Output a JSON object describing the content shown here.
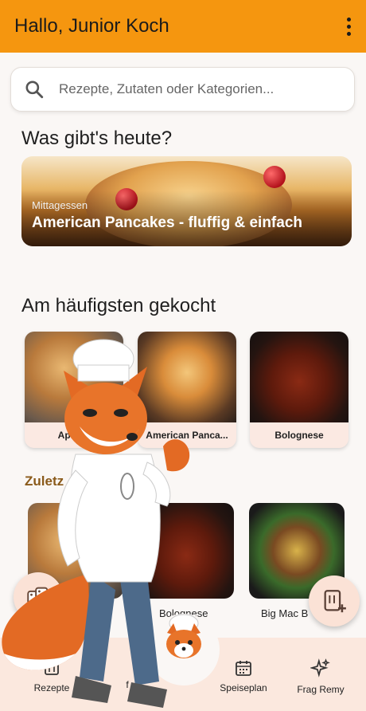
{
  "colors": {
    "appbar": "#f5960f",
    "accent_text": "#8a5a1a",
    "card_bg": "#fbe9e2"
  },
  "header": {
    "title": "Hallo, Junior Koch",
    "menu_icon": "more-vert-icon"
  },
  "search": {
    "placeholder": "Rezepte, Zutaten oder Kategorien...",
    "value": ""
  },
  "today": {
    "heading": "Was gibt's heute?",
    "featured": {
      "category": "Mittagessen",
      "title": "American Pancakes - fluffig & einfach"
    }
  },
  "most_cooked": {
    "heading": "Am häufigsten gekocht",
    "items": [
      {
        "label": "Apfelm"
      },
      {
        "label": "American Panca..."
      },
      {
        "label": "Bolognese"
      }
    ]
  },
  "recent": {
    "heading": "Zuletz",
    "items": [
      {
        "label": ""
      },
      {
        "label": "Bolognese"
      },
      {
        "label": "Big Mac B"
      }
    ]
  },
  "nav": {
    "items": [
      {
        "label": "Rezepte",
        "icon": "recipe-book-icon"
      },
      {
        "label": "f",
        "icon": ""
      },
      {
        "label": "Speiseplan",
        "icon": "calendar-icon"
      },
      {
        "label": "Frag Remy",
        "icon": "sparkles-icon"
      }
    ]
  },
  "fabs": {
    "left": "dice-icon",
    "right": "add-recipe-icon"
  }
}
